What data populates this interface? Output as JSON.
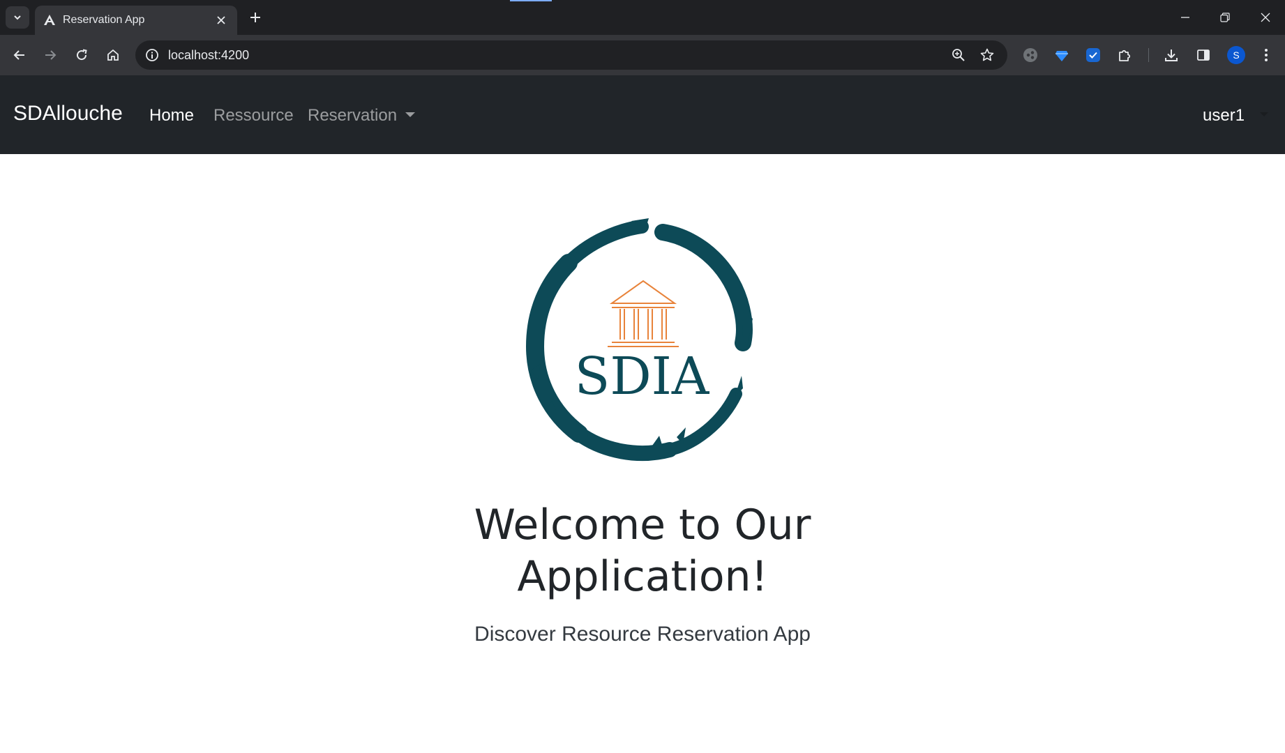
{
  "browser": {
    "tab_title": "Reservation App",
    "url": "localhost:4200",
    "profile_initial": "S"
  },
  "navbar": {
    "brand": "SDAllouche",
    "links": [
      "Home",
      "Ressource",
      "Reservation"
    ],
    "active_link": "Home",
    "user": "user1"
  },
  "hero": {
    "logo_text": "SDIA",
    "title_line1": "Welcome to Our",
    "title_line2": "Application!",
    "subtitle": "Discover Resource Reservation App"
  },
  "colors": {
    "navbar_bg": "#212529",
    "logo_ring": "#0d4a57",
    "logo_icon": "#e8833a"
  }
}
